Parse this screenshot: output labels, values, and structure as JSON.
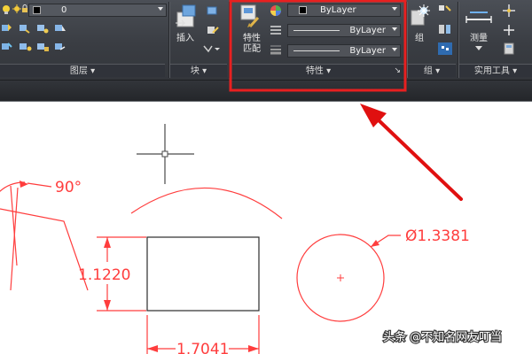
{
  "ribbon": {
    "layer_panel": {
      "layer_value": "0",
      "title": "图层"
    },
    "block_panel": {
      "insert_label": "插入",
      "title": "块"
    },
    "properties_panel": {
      "match_label_line1": "特性",
      "match_label_line2": "匹配",
      "color_value": "ByLayer",
      "linetype_value": "ByLayer",
      "lineweight_value": "ByLayer",
      "title": "特性"
    },
    "group_panel": {
      "group_label": "组",
      "title": "组"
    },
    "utilities_panel": {
      "measure_label": "测量",
      "title": "实用工具"
    }
  },
  "drawing": {
    "angle_dim": "90°",
    "vertical_dim": "1.1220",
    "horizontal_dim": "1.7041",
    "diameter_dim": "Ø1.3381"
  },
  "watermark": "头条 @不知名网友叮当",
  "colors": {
    "ribbon_bg": "#3a3d43",
    "highlight_box": "#e82020",
    "dimension_red": "#ff3d3d",
    "arrow_red": "#e01010"
  }
}
